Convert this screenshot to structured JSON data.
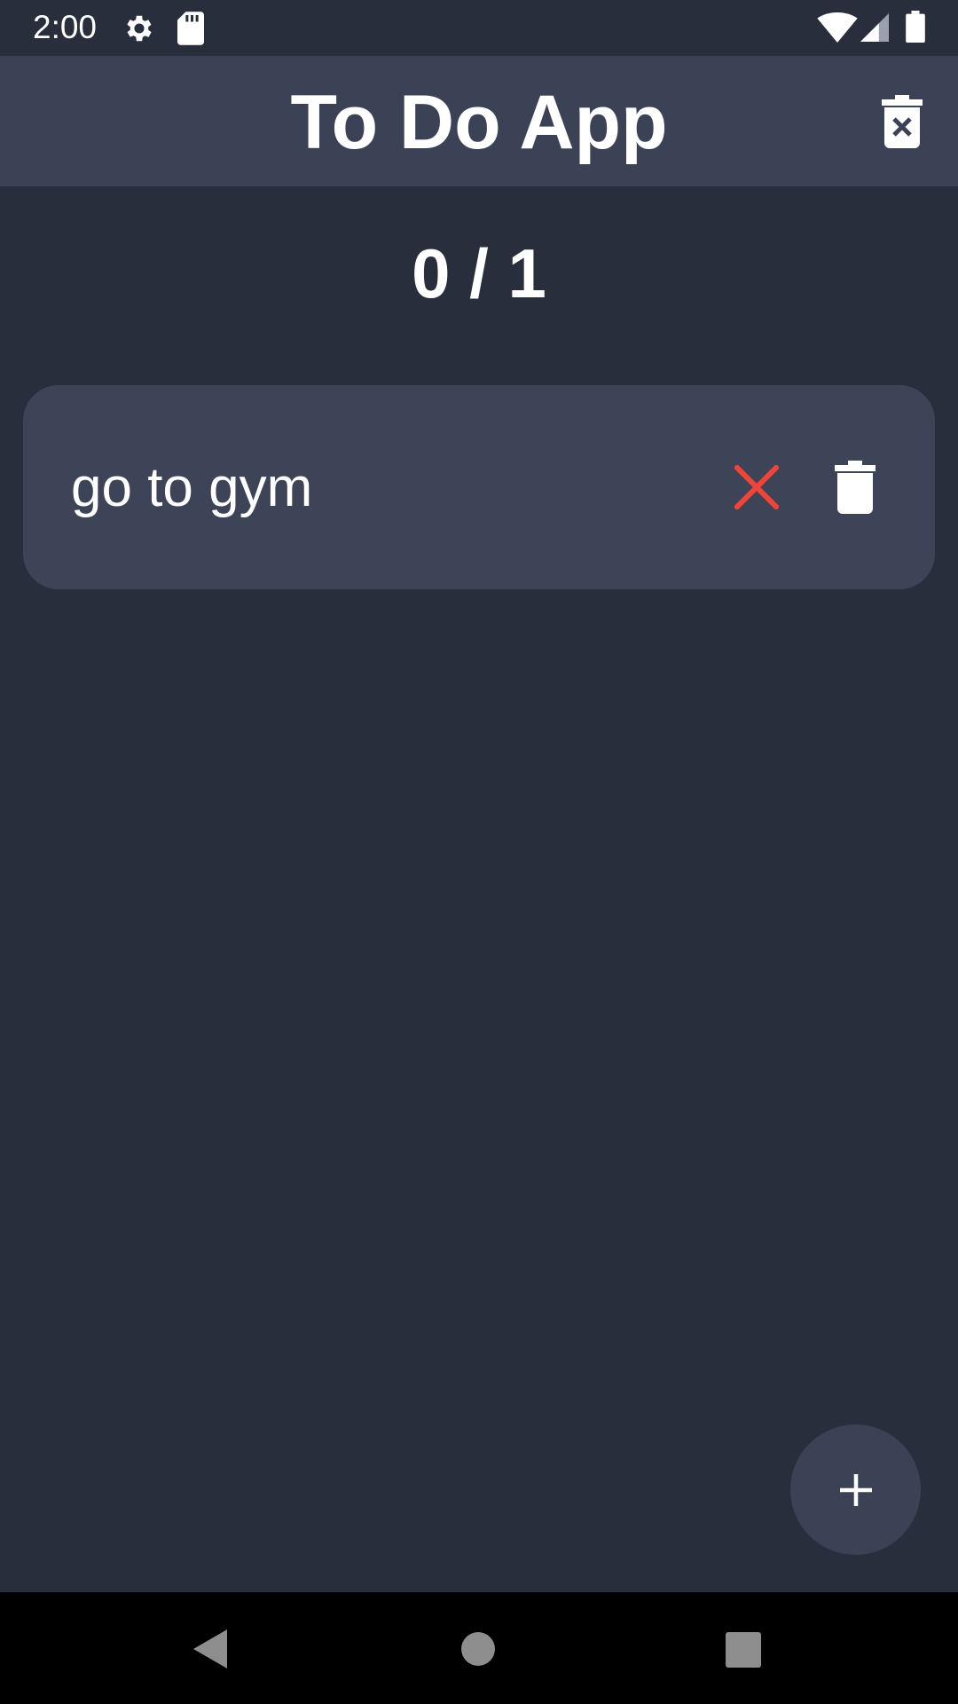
{
  "status_bar": {
    "time": "2:00",
    "icons": [
      "gear-icon",
      "sd-card-icon",
      "wifi-icon",
      "cell-signal-icon",
      "battery-icon"
    ]
  },
  "app_bar": {
    "title": "To Do App",
    "clear_all_icon": "trash-x-icon"
  },
  "counter": {
    "text": "0 / 1",
    "completed": 0,
    "total": 1
  },
  "tasks": [
    {
      "text": "go to gym",
      "completed": false,
      "toggle_icon": "close-icon",
      "delete_icon": "trash-icon"
    }
  ],
  "fab": {
    "icon": "plus-icon"
  },
  "nav_bar": {
    "icons": [
      "back-icon",
      "home-icon",
      "recents-icon"
    ]
  },
  "colors": {
    "background": "#292e3c",
    "app_bar": "#3b4255",
    "card": "#3d4457",
    "accent_red": "#f04438",
    "text": "#ffffff"
  }
}
